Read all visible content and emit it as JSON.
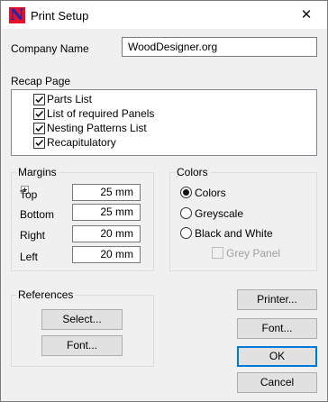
{
  "window": {
    "title": "Print Setup",
    "icon": "woodesigner-app-icon",
    "close_glyph": "✕"
  },
  "company": {
    "label": "Company Name",
    "value": "WoodDesigner.org"
  },
  "recap": {
    "label": "Recap Page",
    "items": [
      {
        "label": "Parts List",
        "checked": true
      },
      {
        "label": "List of required Panels",
        "checked": true
      },
      {
        "label": "Nesting Patterns List",
        "checked": true
      },
      {
        "label": "Recapitulatory",
        "checked": true
      }
    ]
  },
  "margins": {
    "title": "Margins",
    "top_label": "Top",
    "top_value": "25 mm",
    "bottom_label": "Bottom",
    "bottom_value": "25 mm",
    "right_label": "Right",
    "right_value": "20 mm",
    "left_label": "Left",
    "left_value": "20 mm"
  },
  "colors": {
    "title": "Colors",
    "options": [
      "Colors",
      "Greyscale",
      "Black and White"
    ],
    "selected": "Colors",
    "grey_panel_label": "Grey Panel",
    "grey_panel_checked": false,
    "grey_panel_enabled": false
  },
  "references": {
    "title": "References",
    "select_label": "Select...",
    "font_label": "Font..."
  },
  "buttons": {
    "printer": "Printer...",
    "font": "Font...",
    "ok": "OK",
    "cancel": "Cancel"
  },
  "colors_hex": {
    "accent": "#0078d7",
    "icon_red": "#e8102a",
    "icon_blue": "#1a2aa8"
  }
}
